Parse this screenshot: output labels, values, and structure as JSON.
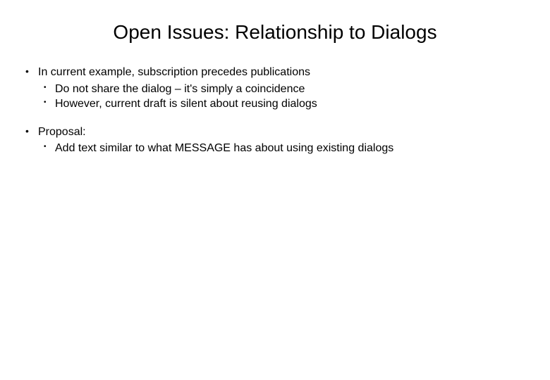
{
  "title": "Open Issues: Relationship to Dialogs",
  "bullets": [
    {
      "text": "In current example, subscription precedes publications",
      "children": [
        "Do not share the dialog – it's simply a coincidence",
        "However, current draft is silent about reusing dialogs"
      ]
    },
    {
      "text": "Proposal:",
      "children": [
        "Add text similar to what MESSAGE has about using existing dialogs"
      ]
    }
  ]
}
